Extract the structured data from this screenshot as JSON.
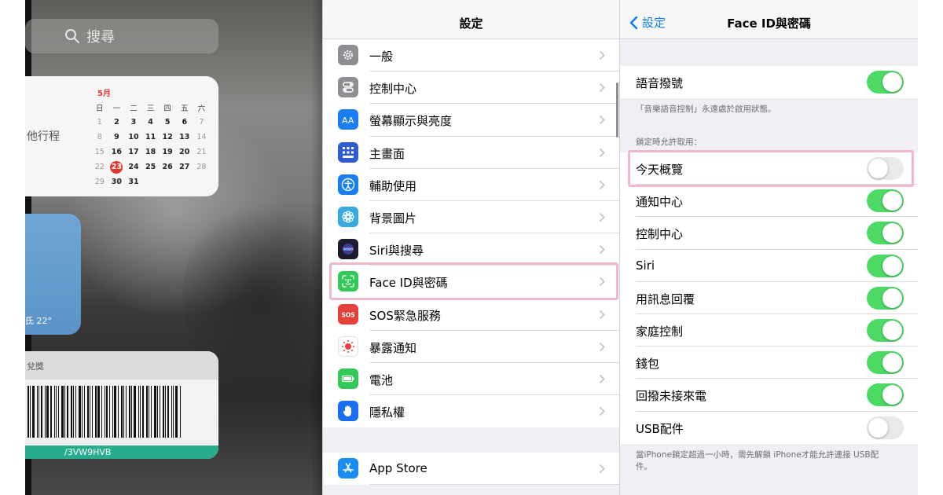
{
  "today": {
    "search_placeholder": "搜尋",
    "calendar": {
      "event_text": "他行程",
      "month": "5月",
      "weekdays": [
        "日",
        "一",
        "二",
        "三",
        "四",
        "五",
        "六"
      ],
      "weeks": [
        [
          "1",
          "2",
          "3",
          "4",
          "5",
          "6",
          "7"
        ],
        [
          "8",
          "9",
          "10",
          "11",
          "12",
          "13",
          "14"
        ],
        [
          "15",
          "16",
          "17",
          "18",
          "19",
          "20",
          "21"
        ],
        [
          "22",
          "23",
          "24",
          "25",
          "26",
          "27",
          "28"
        ],
        [
          "29",
          "30",
          "31",
          "",
          "",
          "",
          ""
        ]
      ],
      "today": "23"
    },
    "weather_text": "氐 22°",
    "wallet": {
      "header": "兌獎",
      "code": "/3VW9HVB"
    }
  },
  "settings": {
    "title": "設定",
    "items": [
      {
        "label": "一般",
        "icon": "gear-icon",
        "color": "#8e8e93"
      },
      {
        "label": "控制中心",
        "icon": "switches-icon",
        "color": "#8e8e93"
      },
      {
        "label": "螢幕顯示與亮度",
        "icon": "text-size-icon",
        "color": "#1a7ef2"
      },
      {
        "label": "主畫面",
        "icon": "home-grid-icon",
        "color": "#2f5bd3"
      },
      {
        "label": "輔助使用",
        "icon": "accessibility-icon",
        "color": "#1a7ef2"
      },
      {
        "label": "背景圖片",
        "icon": "flower-icon",
        "color": "#35aadc"
      },
      {
        "label": "Siri與搜尋",
        "icon": "siri-icon",
        "color": "#1c1c2e"
      },
      {
        "label": "Face ID與密碼",
        "icon": "face-id-icon",
        "color": "#34c759"
      },
      {
        "label": "SOS緊急服務",
        "icon": "sos-icon",
        "color": "#e5413a"
      },
      {
        "label": "暴露通知",
        "icon": "exposure-icon",
        "color": "#ffffff"
      },
      {
        "label": "電池",
        "icon": "battery-icon",
        "color": "#34c759"
      },
      {
        "label": "隱私權",
        "icon": "hand-icon",
        "color": "#1a6ef0"
      }
    ],
    "items2": [
      {
        "label": "App Store",
        "icon": "app-store-icon",
        "color": "#1a8cf6"
      }
    ]
  },
  "faceid": {
    "back_label": "設定",
    "title": "Face ID與密碼",
    "voice_dial": {
      "label": "語音撥號",
      "on": true
    },
    "voice_note": "「音樂語音控制」永遠處於啟用狀態。",
    "locked_header": "鎖定時允許取用：",
    "locked_items": [
      {
        "label": "今天概覽",
        "on": false
      },
      {
        "label": "通知中心",
        "on": true
      },
      {
        "label": "控制中心",
        "on": true
      },
      {
        "label": "Siri",
        "on": true
      },
      {
        "label": "用訊息回覆",
        "on": true
      },
      {
        "label": "家庭控制",
        "on": true
      },
      {
        "label": "錢包",
        "on": true
      },
      {
        "label": "回撥未接來電",
        "on": true
      },
      {
        "label": "USB配件",
        "on": false
      }
    ],
    "usb_note": "當iPhone鎖定超過一小時，需先解鎖 iPhone才能允許連接 USB配件。"
  },
  "colors": {
    "accent": "#0a7cf6",
    "toggle_on": "#4cd964",
    "highlight": "#f2b8c6",
    "calendar_today": "#e0362c"
  }
}
